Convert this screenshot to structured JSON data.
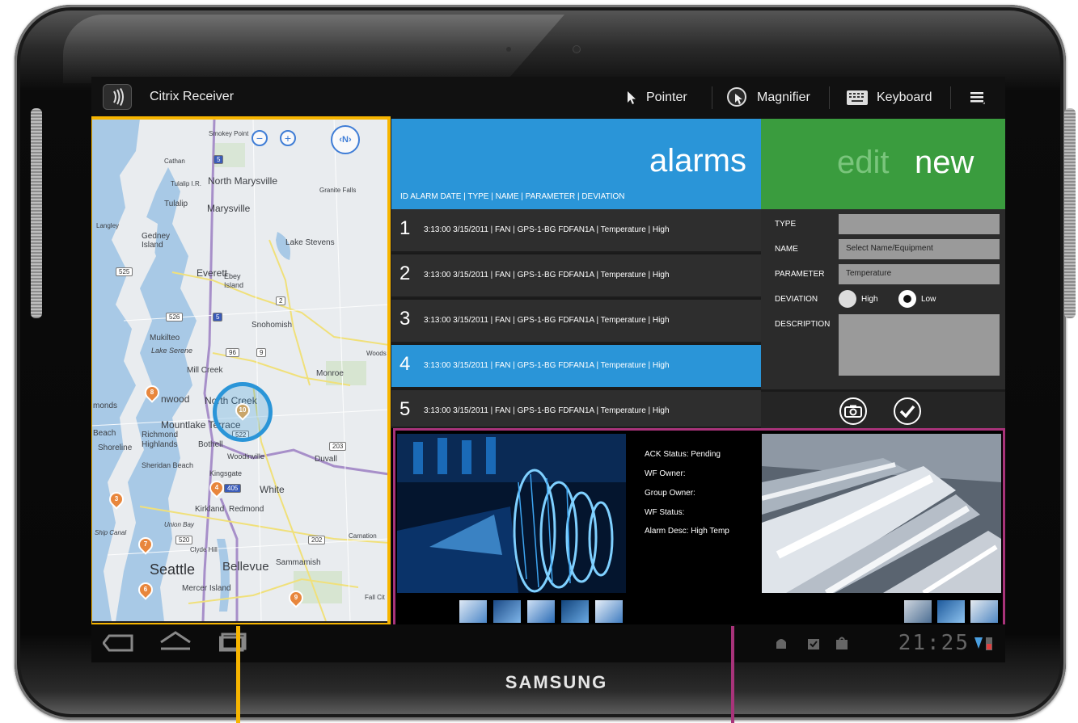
{
  "device": {
    "brand": "SAMSUNG"
  },
  "topbar": {
    "app_title": "Citrix Receiver",
    "pointer_label": "Pointer",
    "magnifier_label": "Magnifier",
    "keyboard_label": "Keyboard"
  },
  "map": {
    "controls": {
      "zoom_out": "−",
      "zoom_in": "+",
      "compass": "N"
    },
    "places": {
      "smokey_point": "Smokey Point",
      "north_marysville": "North Marysville",
      "tulalip_ir": "Tulalip I.R.",
      "tulalip": "Tulalip",
      "cathan": "Cathan",
      "granite_falls": "Granite Falls",
      "marysville": "Marysville",
      "langley": "Langley",
      "gedney_island": "Gedney Island",
      "lake_stevens": "Lake Stevens",
      "everett": "Everett",
      "ebey_island": "Ebey Island",
      "snohomish": "Snohomish",
      "mukilteo": "Mukilteo",
      "lake_serene": "Lake Serene",
      "mill_creek": "Mill Creek",
      "woods_creek": "Woods Cr.",
      "monroe": "Monroe",
      "edmonds": "monds",
      "lynnwood": "nwood",
      "north_creek": "North Creek",
      "mountlake_terrace": "Mountlake Terrace",
      "richmond_beach": "Beach",
      "shoreline": "Shoreline",
      "richmond_highlands": "Richmond Highlands",
      "bothell": "Bothell",
      "woodinville": "Woodinville",
      "duvall": "Duvall",
      "sheridan_beach": "Sheridan Beach",
      "kingsgate": "Kingsgate",
      "white": "White",
      "kirkland": "Kirkland",
      "redmond": "Redmond",
      "union_bay": "Union Bay",
      "ship_canal": "Ship Canal",
      "clyde_hill": "Clyde Hill",
      "carnation": "Carnation",
      "seattle": "Seattle",
      "bellevue": "Bellevue",
      "sammamish": "Sammamish",
      "mercer_island": "Mercer Island",
      "fall_city": "Fall Cit"
    },
    "shields": [
      "5",
      "525",
      "526",
      "2",
      "96",
      "9",
      "203",
      "405",
      "202",
      "520",
      "5",
      "522"
    ],
    "pins": [
      {
        "id": "8"
      },
      {
        "id": "4"
      },
      {
        "id": "3"
      },
      {
        "id": "7"
      },
      {
        "id": "6"
      },
      {
        "id": "9"
      },
      {
        "id": "10"
      }
    ]
  },
  "alarms": {
    "title": "alarms",
    "columns": "ID      ALARM DATE          | TYPE  | NAME                          | PARAMETER    | DEVIATION",
    "rows": [
      {
        "id": "1",
        "text": "3:13:00 3/15/2011  |  FAN    |  GPS-1-BG FDFAN1A  |  Temperature      |  High"
      },
      {
        "id": "2",
        "text": "3:13:00 3/15/2011  |  FAN    |  GPS-1-BG FDFAN1A  |  Temperature      |  High"
      },
      {
        "id": "3",
        "text": "3:13:00 3/15/2011  |  FAN    |  GPS-1-BG FDFAN1A  |  Temperature      |  High"
      },
      {
        "id": "4",
        "text": "3:13:00 3/15/2011  |  FAN    |  GPS-1-BG FDFAN1A  |  Temperature      |  High"
      },
      {
        "id": "5",
        "text": "3:13:00 3/15/2011  |  FAN    |  GPS-1-BG FDFAN1A  |  Temperature      |  High"
      }
    ],
    "selected_row": "4"
  },
  "editor": {
    "edit_label": "edit",
    "new_label": "new",
    "type_label": "TYPE",
    "type_value": "",
    "name_label": "NAME",
    "name_placeholder": "Select Name/Equipment",
    "parameter_label": "PARAMETER",
    "parameter_value": "Temperature",
    "deviation_label": "DEVIATION",
    "deviation_high": "High",
    "deviation_low": "Low",
    "deviation_selected": "Low",
    "description_label": "DESCRIPTION",
    "description_value": ""
  },
  "details": {
    "ack_status": "ACK Status: Pending",
    "wf_owner": "WF Owner:",
    "group_owner": "Group Owner:",
    "wf_status": "WF Status:",
    "alarm_desc": "Alarm Desc: High Temp"
  },
  "statusbar": {
    "clock": "21:25"
  },
  "colors": {
    "alarms_blue": "#2a95d8",
    "editor_green": "#3a9c3e",
    "map_highlight": "#f7b500",
    "media_highlight": "#a8337a"
  }
}
